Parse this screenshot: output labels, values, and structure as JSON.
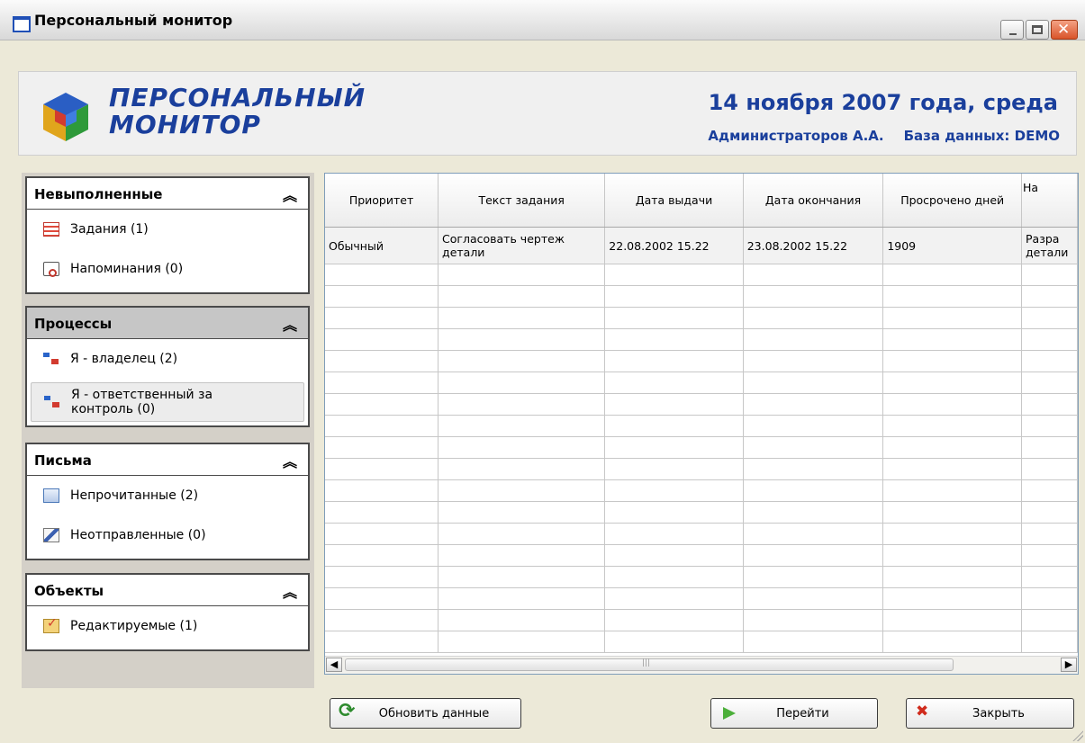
{
  "window": {
    "title": "Персональный монитор"
  },
  "header": {
    "logo_line1": "ПЕРСОНАЛЬНЫЙ",
    "logo_line2": "МОНИТОР",
    "date": "14 ноября 2007 года, среда",
    "user": "Администраторов А.А.",
    "database": "База данных: DEMO"
  },
  "sidebar": {
    "groups": [
      {
        "title": "Невыполненные",
        "items": [
          {
            "label": "Задания (1)",
            "icon": "tasks-icon"
          },
          {
            "label": "Напоминания (0)",
            "icon": "reminder-icon"
          }
        ]
      },
      {
        "title": "Процессы",
        "items": [
          {
            "label": "Я - владелец (2)",
            "icon": "process-icon"
          },
          {
            "label": "Я - ответственный за контроль (0)",
            "icon": "process-icon"
          }
        ]
      },
      {
        "title": "Письма",
        "items": [
          {
            "label": "Непрочитанные (2)",
            "icon": "envelope-icon"
          },
          {
            "label": "Неотправленные (0)",
            "icon": "edit-letter-icon"
          }
        ]
      },
      {
        "title": "Объекты",
        "items": [
          {
            "label": "Редактируемые (1)",
            "icon": "checkbox-icon"
          }
        ]
      }
    ]
  },
  "table": {
    "columns": [
      "Приоритет",
      "Текст задания",
      "Дата выдачи",
      "Дата окончания",
      "Просрочено дней",
      "На"
    ],
    "rows": [
      [
        "Обычный",
        "Согласовать чертеж детали",
        "22.08.2002 15.22",
        "23.08.2002 15.22",
        "1909",
        "Разра детали"
      ]
    ]
  },
  "buttons": {
    "refresh": "Обновить данные",
    "go": "Перейти",
    "close": "Закрыть"
  },
  "colors": {
    "brand_blue": "#1a3f9c",
    "window_bg": "#ece9d8"
  }
}
